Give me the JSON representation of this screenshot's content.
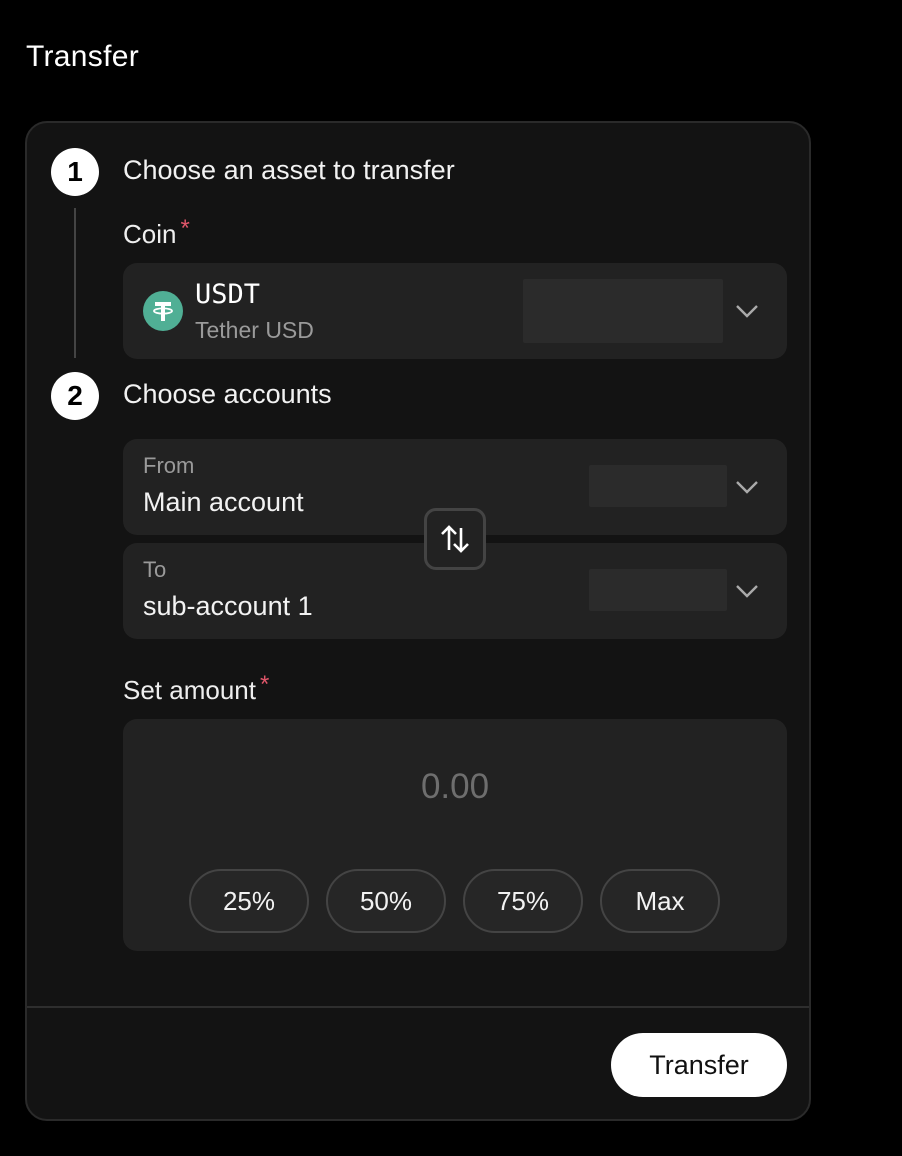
{
  "page": {
    "title": "Transfer"
  },
  "steps": [
    {
      "number": "1",
      "title": "Choose an asset to transfer"
    },
    {
      "number": "2",
      "title": "Choose accounts"
    }
  ],
  "coin": {
    "label": "Coin",
    "required_mark": "*",
    "code": "USDT",
    "name": "Tether USD",
    "icon": "tether-icon",
    "icon_color": "#50af95"
  },
  "accounts": {
    "from": {
      "caption": "From",
      "value": "Main account"
    },
    "to": {
      "caption": "To",
      "value": "sub-account 1"
    },
    "swap_icon": "swap-arrows-icon"
  },
  "amount": {
    "label": "Set amount",
    "required_mark": "*",
    "value": "0.00",
    "presets": [
      "25%",
      "50%",
      "75%",
      "Max"
    ]
  },
  "actions": {
    "submit_label": "Transfer"
  },
  "colors": {
    "background": "#000000",
    "card": "#131313",
    "field": "#222222",
    "required": "#e0566a",
    "accent_button": "#ffffff"
  }
}
